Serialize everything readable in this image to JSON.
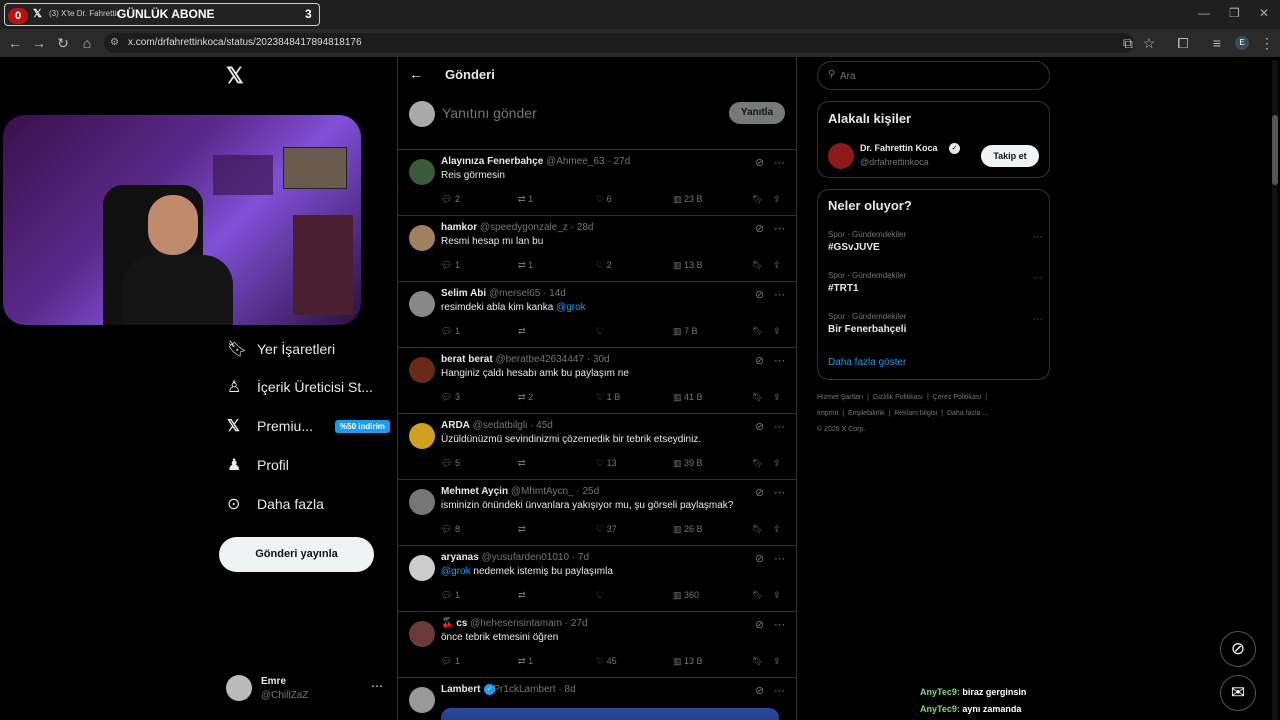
{
  "overlay": {
    "left_count": "0",
    "title": "GÜNLÜK ABONE",
    "right_count": "3"
  },
  "browser": {
    "tab_title": "(3) X'te Dr. Fahrettin",
    "url": "x.com/drfahrettinkoca/status/2023848417894818176",
    "profile_initial": "E"
  },
  "timeline": {
    "header_title": "Gönderi",
    "reply_placeholder": "Yanıtını gönder",
    "reply_button": "Yanıtla",
    "tweets": [
      {
        "name": "Alayınıza Fenerbahçe",
        "handle": "@Ahmee_63",
        "time": "· 27d",
        "text": "Reis görmesin",
        "mention": "",
        "replies": "2",
        "retweets": "1",
        "likes": "6",
        "views": "23 B"
      },
      {
        "name": "hamkor",
        "handle": "@speedygonzale_z",
        "time": "· 28d",
        "text": "Resmi hesap mı lan bu",
        "mention": "",
        "replies": "1",
        "retweets": "1",
        "likes": "2",
        "views": "13 B"
      },
      {
        "name": "Selim Abi",
        "handle": "@mersel65",
        "time": "· 14d",
        "text": "resimdeki abla kim kanka ",
        "mention": "@grok",
        "replies": "1",
        "retweets": "",
        "likes": "",
        "views": "7 B"
      },
      {
        "name": "berat berat",
        "handle": "@beratbe42634447",
        "time": "· 30d",
        "text": "Hanginiz çaldı hesabı amk bu paylaşım ne",
        "mention": "",
        "replies": "3",
        "retweets": "2",
        "likes": "1 B",
        "views": "41 B"
      },
      {
        "name": "ARDA",
        "handle": "@sedatbilgli",
        "time": "· 45d",
        "text": "Üzüldünüzmü sevindinizmi çözemedik bir tebrik etseydiniz.",
        "mention": "",
        "replies": "5",
        "retweets": "",
        "likes": "13",
        "views": "39 B"
      },
      {
        "name": "Mehmet Ayçin",
        "handle": "@MhmtAycn_",
        "time": "· 25d",
        "text": "isminizin önündeki ünvanlara yakışıyor mu, şu görseli paylaşmak?",
        "mention": "",
        "replies": "8",
        "retweets": "",
        "likes": "37",
        "views": "26 B"
      },
      {
        "name": "aryanas",
        "handle": "@yusufarden01010",
        "time": "· 7d",
        "text": " nedemek istemiş bu paylaşımla",
        "mention_first": "@grok",
        "replies": "1",
        "retweets": "",
        "likes": "",
        "views": "360"
      },
      {
        "name": "🍒 cs",
        "handle": "@hehesensintamam",
        "time": "· 27d",
        "text": "önce tebrik etmesini öğren",
        "mention": "",
        "replies": "1",
        "retweets": "1",
        "likes": "45",
        "views": "13 B"
      },
      {
        "name": "Lambert",
        "handle": "@Pr1ckLambert",
        "time": "· 8d",
        "text": "",
        "mention": "",
        "replies": "",
        "retweets": "",
        "likes": "",
        "views": ""
      }
    ]
  },
  "left_nav": {
    "items": [
      {
        "label": "Yer İşaretleri"
      },
      {
        "label": "İçerik Üreticisi St..."
      },
      {
        "label": "Premiu...",
        "badge": "%50 indirim"
      },
      {
        "label": "Profil"
      },
      {
        "label": "Daha fazla"
      }
    ],
    "post_button": "Gönderi yayınla",
    "account_name": "Emre",
    "account_handle": "@ChillZaZ"
  },
  "right": {
    "search_placeholder": "Ara",
    "related_title": "Alakalı kişiler",
    "person_name": "Dr. Fahrettin Koca",
    "person_handle": "@drfahrettinkoca",
    "follow_button": "Takip et",
    "trends_title": "Neler oluyor?",
    "trends": [
      {
        "meta": "Spor · Gündemdekiler",
        "name": "#GSvJUVE"
      },
      {
        "meta": "Spor · Gündemdekiler",
        "name": "#TRT1"
      },
      {
        "meta": "Spor · Gündemdekiler",
        "name": "Bir Fenerbahçeli"
      }
    ],
    "show_more": "Daha fazla göster",
    "footer": [
      "Hizmet Şartları",
      "Gizlilik Politikası",
      "Çerez Politikası",
      "Imprint",
      "Erişilebilirlik",
      "Reklam bilgisi",
      "Daha fazla ...",
      "© 2026 X Corp."
    ]
  },
  "chat": [
    {
      "user": "AnyTec9:",
      "msg": " biraz gerginsin"
    },
    {
      "user": "AnyTec9:",
      "msg": " aynı zamanda"
    }
  ]
}
